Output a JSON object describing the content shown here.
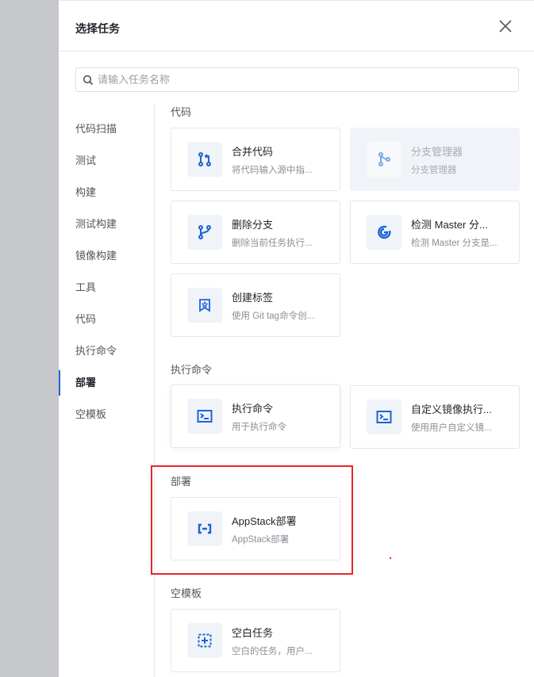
{
  "dialog": {
    "title": "选择任务",
    "search_placeholder": "请输入任务名称"
  },
  "nav": [
    "代码扫描",
    "测试",
    "构建",
    "测试构建",
    "镜像构建",
    "工具",
    "代码",
    "执行命令",
    "部署",
    "空模板"
  ],
  "active_nav": "部署",
  "sections": [
    {
      "title": "代码",
      "cards": [
        {
          "name": "合并代码",
          "desc": "将代码输入源中指...",
          "icon": "merge-icon"
        },
        {
          "name": "分支管理器",
          "desc": "分支管理器",
          "icon": "branch-manager-icon",
          "disabled": true
        },
        {
          "name": "删除分支",
          "desc": "删除当前任务执行...",
          "icon": "branch-icon"
        },
        {
          "name": "检测 Master 分...",
          "desc": "检测 Master 分支是...",
          "icon": "detect-icon"
        },
        {
          "name": "创建标签",
          "desc": "使用 Git tag命令创...",
          "icon": "tag-icon"
        }
      ]
    },
    {
      "title": "执行命令",
      "cards": [
        {
          "name": "执行命令",
          "desc": "用于执行命令",
          "icon": "terminal-icon"
        },
        {
          "name": "自定义镜像执行...",
          "desc": "使用用户自定义镜...",
          "icon": "terminal-icon"
        }
      ]
    },
    {
      "title": "部署",
      "cards": [
        {
          "name": "AppStack部署",
          "desc": "AppStack部署",
          "icon": "appstack-icon"
        }
      ]
    },
    {
      "title": "空模板",
      "cards": [
        {
          "name": "空白任务",
          "desc": "空白的任务，用户...",
          "icon": "blank-task-icon"
        }
      ]
    }
  ],
  "colors": {
    "accent": "#1b64d8",
    "highlight": "#e8262a"
  }
}
